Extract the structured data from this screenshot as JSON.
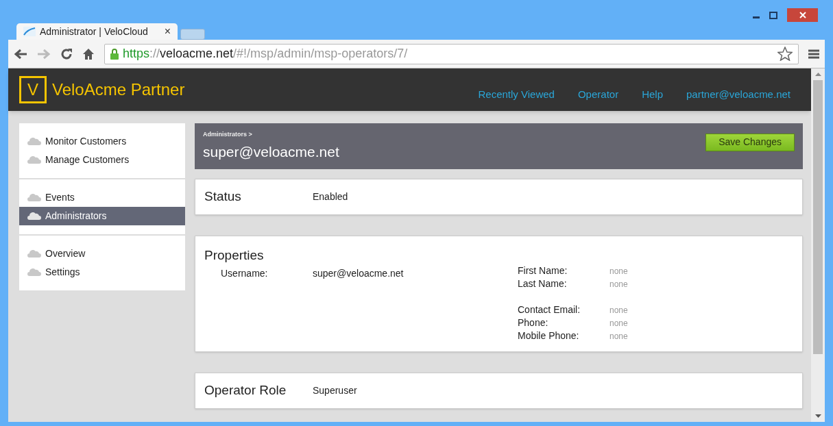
{
  "browser": {
    "tab_title": "Administrator | VeloCloud",
    "tab_close": "×",
    "url": {
      "scheme": "https",
      "separator": "://",
      "host": "veloacme.net",
      "path": "/#!/msp/admin/msp-operators/7/"
    }
  },
  "app": {
    "logo_letter": "V",
    "title": "VeloAcme Partner",
    "nav": [
      "Recently Viewed",
      "Operator",
      "Help",
      "partner@veloacme.net"
    ]
  },
  "sidebar": {
    "groups": [
      [
        {
          "label": "Monitor Customers",
          "selected": false
        },
        {
          "label": "Manage Customers",
          "selected": false
        }
      ],
      [
        {
          "label": "Events",
          "selected": false
        },
        {
          "label": "Administrators",
          "selected": true
        }
      ],
      [
        {
          "label": "Overview",
          "selected": false
        },
        {
          "label": "Settings",
          "selected": false
        }
      ]
    ]
  },
  "header": {
    "breadcrumb": "Administrators >",
    "title": "super@veloacme.net",
    "save_button": "Save Changes"
  },
  "status": {
    "heading": "Status",
    "value": "Enabled"
  },
  "properties": {
    "heading": "Properties",
    "username_label": "Username:",
    "username_value": "super@veloacme.net",
    "right_groups": [
      [
        {
          "label": "First Name:",
          "value": "none"
        },
        {
          "label": "Last Name:",
          "value": "none"
        }
      ],
      [
        {
          "label": "Contact Email:",
          "value": "none"
        },
        {
          "label": "Phone:",
          "value": "none"
        },
        {
          "label": "Mobile Phone:",
          "value": "none"
        }
      ]
    ]
  },
  "operator_role": {
    "heading": "Operator Role",
    "value": "Superuser"
  }
}
